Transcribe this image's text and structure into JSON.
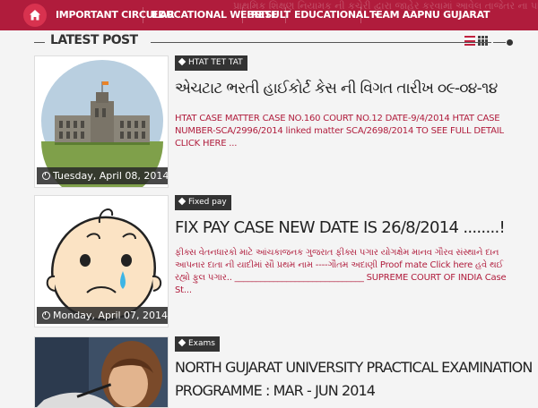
{
  "navbar": {
    "ticker_text": "પ્રાથમિક શિક્ષણ નિયામક ની કચેરી દ્વારા જાહેર કરવામાં આવેલ તાજેતર ના પરિપત્ર તથા અન્ય",
    "home_icon": "home-icon",
    "items": [
      {
        "label": "IMPORTANT CIRCULAR"
      },
      {
        "label": "EDUCATIONAL WEBSITE"
      },
      {
        "label": "RESULT"
      },
      {
        "label": "EDUCATIONAL"
      },
      {
        "label": "TEAM AAPNU GUJARAT"
      }
    ],
    "accent_color": "#b01c3c"
  },
  "section": {
    "title": "LATEST POST",
    "view_icons": [
      "list-view-icon",
      "grid-view-icon"
    ]
  },
  "posts": [
    {
      "label": "HTAT TET TAT",
      "title": "એચટાટ ભરતી હાઈકોર્ટ કેસ ની વિગત તારીખ ૦૯-૦૪-૧૪",
      "snippet": "HTAT CASE MATTER CASE NO.160 COURT NO.12 DATE-9/4/2014 HTAT CASE NUMBER-SCA/2996/2014   linked matter SCA/2698/2014     TO SEE FULL DETAIL CLICK HERE ...",
      "date": "Tuesday, April 08, 2014",
      "thumbnail": "high-court-building-image"
    },
    {
      "label": "Fixed pay",
      "title": "FIX PAY CASE NEW DATE IS 26/8/2014 ........!",
      "snippet": "ફીક્સ વેતનધારકો માટે આંચકાજનક ગુજરાત ફીક્સ પગાર યોગક્ષેમ માનવ ગૌરવ સંસ્થાને દાન આપનાર દાતા ની યાદીમાં સૌ પ્રથમ નામ ----ગૌતમ અદાણી Proof mate Click here હવે થઈ રહ્યો ફુલ પગાર.. ______________________________ SUPREME COURT OF INDIA Case St...",
      "date": "Monday, April 07, 2014",
      "thumbnail": "crying-baby-cartoon-image"
    },
    {
      "label": "Exams",
      "title_line1": "NORTH GUJARAT UNIVERSITY PRACTICAL EXAMINATION",
      "title_line2": "PROGRAMME : MAR - JUN 2014",
      "thumbnail": "student-writing-image"
    }
  ]
}
